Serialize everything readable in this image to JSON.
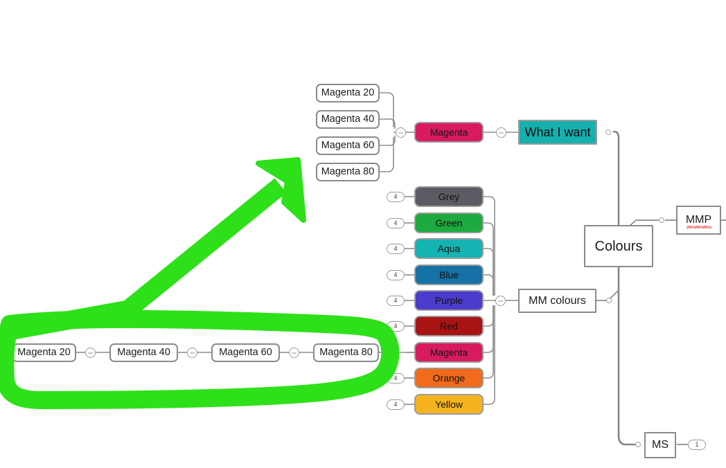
{
  "app": {
    "kind": "mind-map-canvas",
    "background": "#ffffff"
  },
  "central": {
    "label": "Colours"
  },
  "branches": {
    "mmp": {
      "label": "MMP",
      "spellcheck_error": true
    },
    "mm_colours": {
      "label": "MM colours"
    },
    "ms": {
      "label": "MS",
      "child_count": "1"
    },
    "what_i_want": {
      "label": "What I want",
      "color": "#16b0ae"
    }
  },
  "colour_nodes": [
    {
      "label": "Grey",
      "color": "#5b5b63",
      "text": "#111111",
      "badge": "4",
      "state": "collapsed"
    },
    {
      "label": "Green",
      "color": "#1daa3e",
      "text": "#111111",
      "badge": "4",
      "state": "collapsed"
    },
    {
      "label": "Aqua",
      "color": "#16b3b3",
      "text": "#111111",
      "badge": "4",
      "state": "collapsed"
    },
    {
      "label": "Blue",
      "color": "#1571a6",
      "text": "#111111",
      "badge": "4",
      "state": "collapsed"
    },
    {
      "label": "Purple",
      "color": "#4a3ccc",
      "text": "#111111",
      "badge": "4",
      "state": "collapsed"
    },
    {
      "label": "Red",
      "color": "#a81414",
      "text": "#111111",
      "badge": "4",
      "state": "collapsed"
    },
    {
      "label": "Magenta",
      "color": "#d81b5f",
      "text": "#111111",
      "badge": "",
      "state": "expanded"
    },
    {
      "label": "Orange",
      "color": "#f26a1b",
      "text": "#111111",
      "badge": "4",
      "state": "collapsed"
    },
    {
      "label": "Yellow",
      "color": "#f5b41e",
      "text": "#111111",
      "badge": "4",
      "state": "collapsed"
    }
  ],
  "magenta_top_children": [
    {
      "label": "Magenta 20"
    },
    {
      "label": "Magenta 40"
    },
    {
      "label": "Magenta 60"
    },
    {
      "label": "Magenta 80"
    }
  ],
  "magenta_chain": [
    {
      "label": "Magenta 20"
    },
    {
      "label": "Magenta 40"
    },
    {
      "label": "Magenta 60"
    },
    {
      "label": "Magenta 80"
    }
  ],
  "magenta_swatch": {
    "label": "Magenta",
    "color": "#d81b5f"
  },
  "annotation": {
    "tool": "highlighter-pen",
    "color": "#2ee019",
    "shapes": [
      "circle-around-magenta-chain",
      "arrow-pointing-up-right"
    ]
  }
}
